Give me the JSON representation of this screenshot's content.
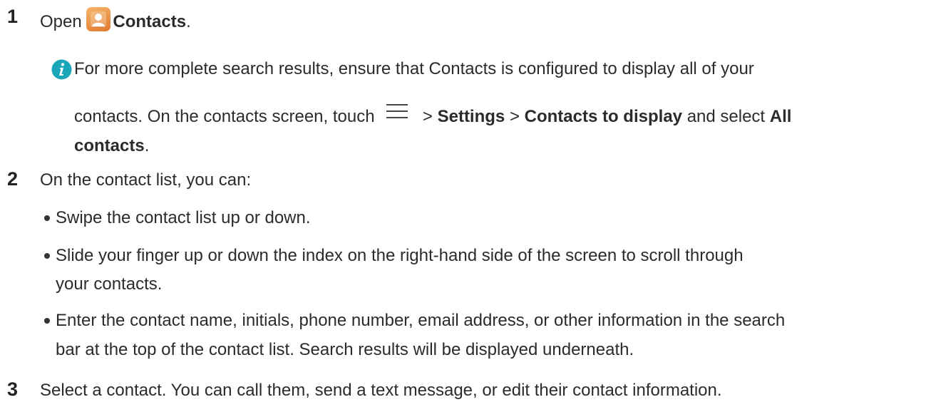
{
  "steps": [
    {
      "number": "1",
      "open_word": "Open",
      "app_name": "Contacts",
      "period": ".",
      "note": {
        "line1": "For more complete search results, ensure that Contacts is configured to display all of your",
        "line2_pre": "contacts. On the contacts screen, touch",
        "sep1": ">",
        "settings": "Settings",
        "sep2": ">",
        "contacts_to_display": "Contacts to display",
        "and_select": "and select",
        "all": "All",
        "contacts_word": "contacts",
        "period": "."
      }
    },
    {
      "number": "2",
      "intro": "On the contact list, you can:",
      "bullets": [
        {
          "line1": "Swipe the contact list up or down."
        },
        {
          "line1": "Slide your finger up or down the index on the right-hand side of the screen to scroll through",
          "line2": "your contacts."
        },
        {
          "line1": "Enter the contact name, initials, phone number, email address, or other information in the search",
          "line2": "bar at the top of the contact list. Search results will be displayed underneath."
        }
      ]
    },
    {
      "number": "3",
      "text": "Select a contact. You can call them, send a text message, or edit their contact information."
    }
  ],
  "icons": {
    "app": "contacts-app-icon",
    "info": "info-icon",
    "menu": "menu-icon"
  },
  "colors": {
    "info_teal": "#1aa5b8",
    "app_orange": "#e8893f",
    "text": "#2b2b2b"
  }
}
